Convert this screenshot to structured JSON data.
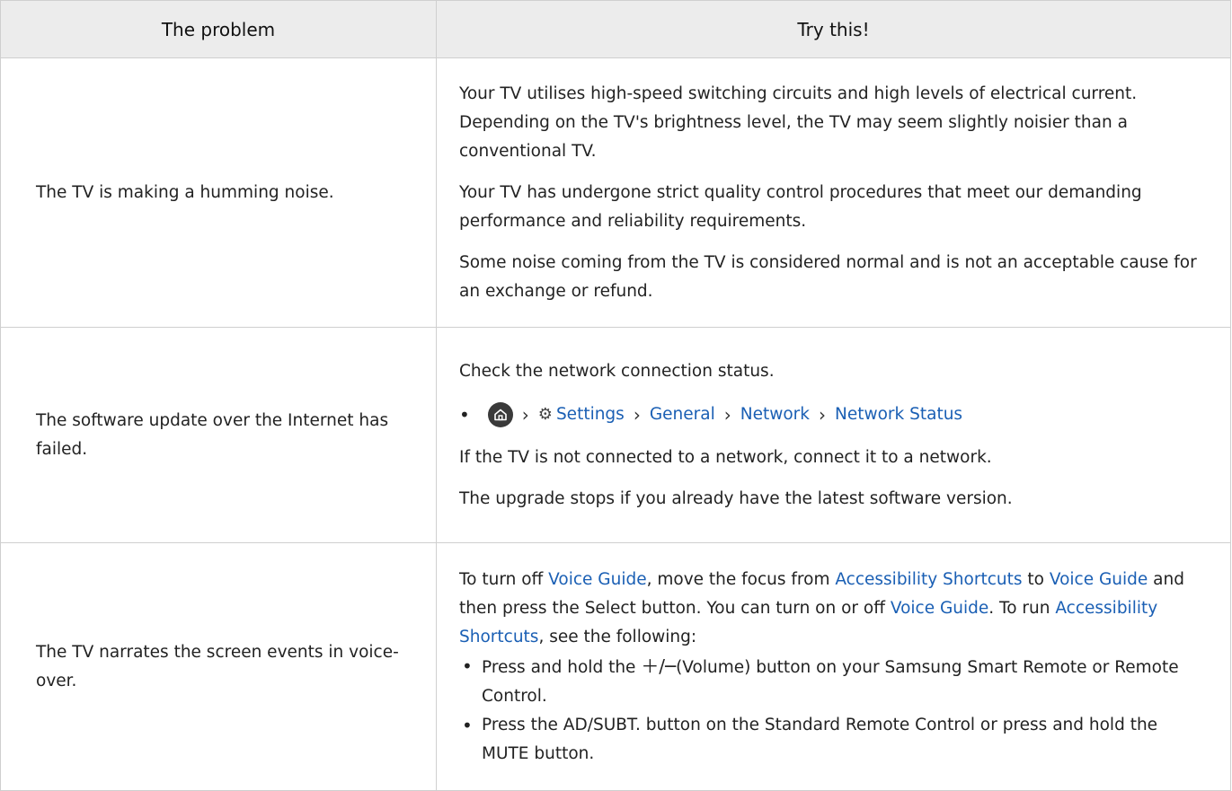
{
  "header": {
    "col1": "The problem",
    "col2": "Try this!"
  },
  "rows": [
    {
      "problem": "The TV is making a humming noise.",
      "paragraphs": [
        "Your TV utilises high-speed switching circuits and high levels of electrical current. Depending on the TV's brightness level, the TV may seem slightly noisier than a conventional TV.",
        "Your TV has undergone strict quality control procedures that meet our demanding performance and reliability requirements.",
        "Some noise coming from the TV is considered normal and is not an acceptable cause for an exchange or refund."
      ]
    },
    {
      "problem": "The software update over the Internet has failed.",
      "intro": "Check the network connection status.",
      "menu_path": [
        "Settings",
        "General",
        "Network",
        "Network Status"
      ],
      "outro": [
        "If the TV is not connected to a network, connect it to a network.",
        "The upgrade stops if you already have the latest software version."
      ]
    },
    {
      "problem": "The TV narrates the screen events in voice-over.",
      "intro": {
        "t1": "To turn off ",
        "l1": "Voice Guide",
        "t2": ", move the focus from ",
        "l2": "Accessibility Shortcuts",
        "t3": " to ",
        "l3": "Voice Guide",
        "t4": " and then press the Select button. You can turn on or off ",
        "l4": "Voice Guide",
        "t5": ". To run ",
        "l5": "Accessibility Shortcuts",
        "t6": ", see the following:"
      },
      "bullets": {
        "b1_pre": "Press and hold the ",
        "b1_post": "(Volume) button on your Samsung Smart Remote or Remote Control.",
        "b2": "Press the AD/SUBT. button on the Standard Remote Control or press and hold the MUTE button."
      }
    }
  ],
  "icons": {
    "home": "home-icon",
    "chevron": "chevron-right-icon",
    "gear": "gear-icon",
    "volume": "volume-plus-minus-icon"
  },
  "colors": {
    "link": "#1a5fb4",
    "header_bg": "#ececec",
    "border": "#cfcfcf"
  }
}
